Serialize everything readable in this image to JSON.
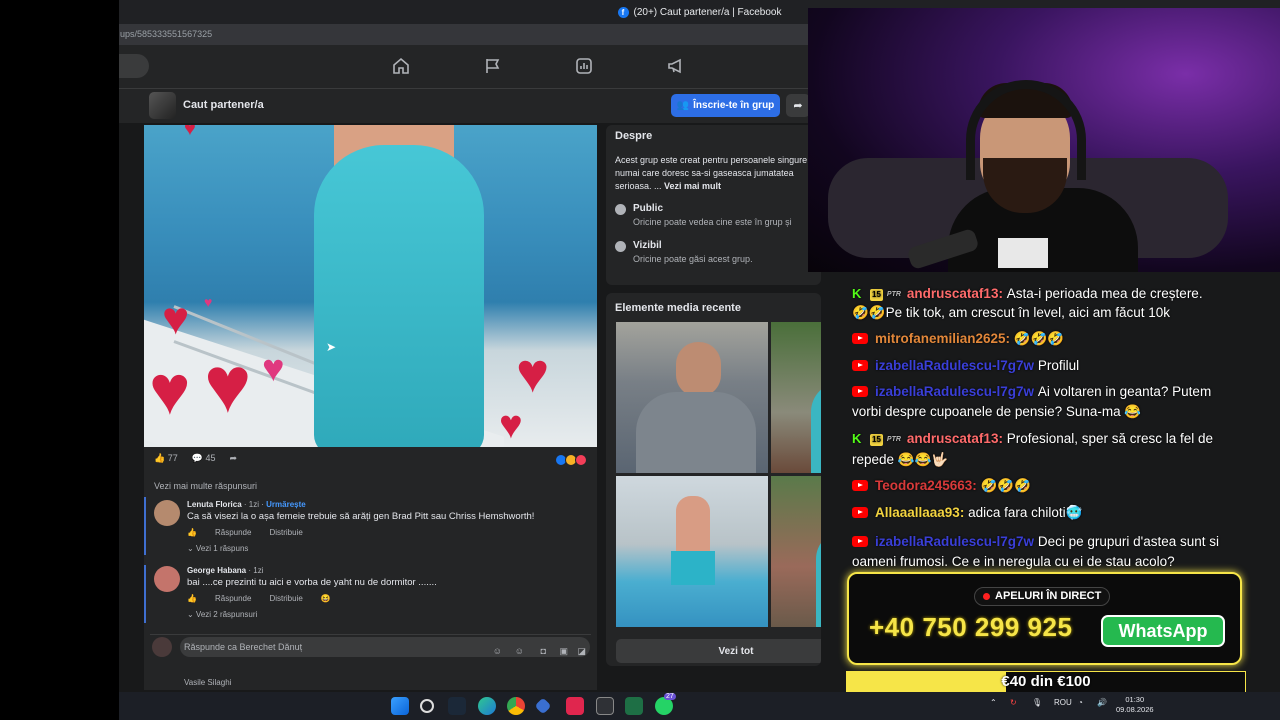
{
  "browser": {
    "title": "(20+) Caut partener/a | Facebook",
    "url_fragment": "ups/585333551567325",
    "favicon": "f"
  },
  "fb_nav": {
    "icons": [
      "home-icon",
      "flag-icon",
      "chart-icon",
      "megaphone-icon"
    ]
  },
  "group": {
    "name": "Caut partener/a",
    "join_label": "Înscrie-te în grup",
    "share_icon": "➦"
  },
  "post": {
    "likes": "77",
    "comments": "45",
    "more_replies": "Vezi mai multe răspunsuri",
    "comments_list": [
      {
        "name": "Lenuta Florica",
        "time": " · 1zi · ",
        "follow": "Urmărește",
        "text": "Ca să visezi la o așa femeie trebuie să arăți gen Brad Pitt sau Chriss Hemshworth!",
        "reply": "Răspunde",
        "share": "Distribuie",
        "replies": "⌄ Vezi 1 răspuns"
      },
      {
        "name": "George Habana",
        "time": " · 1zi",
        "follow": "",
        "text": "bai ....ce prezinti tu aici e vorba de yaht nu de dormitor .......",
        "reply": "Răspunde",
        "share": "Distribuie",
        "replies": "⌄ Vezi 2 răspunsuri"
      }
    ],
    "reply_placeholder": "Răspunde ca Berechet Dănuț",
    "next_commenter": "Vasile Silaghi"
  },
  "about": {
    "title": "Despre",
    "desc": "Acest grup este creat pentru persoanele singure numai care doresc sa-si gaseasca jumatatea serioasa. ... ",
    "see_more": "Vezi mai mult",
    "public_title": "Public",
    "public_sub": "Oricine poate vedea cine este în grup și",
    "visible_title": "Vizibil",
    "visible_sub": "Oricine poate găsi acest grup."
  },
  "media": {
    "title": "Elemente media recente",
    "see_all": "Vezi tot"
  },
  "chat": {
    "messages": [
      {
        "platform": "kick",
        "level": "15",
        "tag": "PTR",
        "user": "andruscataf13:",
        "color": "#ff6b6b",
        "text": "Asta-i perioada mea de creștere."
      },
      {
        "platform": "none",
        "level": "",
        "tag": "",
        "user": "",
        "color": "#ffffff",
        "text": "🤣🤣Pe tik tok, am crescut în level, aici am făcut 10k"
      },
      {
        "platform": "youtube",
        "level": "",
        "tag": "",
        "user": "mitrofanemilian2625:",
        "color": "#e2873a",
        "text": "🤣🤣🤣"
      },
      {
        "platform": "youtube",
        "level": "",
        "tag": "",
        "user": "izabellaRadulescu-l7g7w",
        "color": "#3a3fd8",
        "text": "Profilul"
      },
      {
        "platform": "youtube",
        "level": "",
        "tag": "",
        "user": "izabellaRadulescu-l7g7w",
        "color": "#3a3fd8",
        "text": "Ai voltaren in geanta? Putem vorbi despre cupoanele de pensie? Suna-ma 😂"
      },
      {
        "platform": "kick",
        "level": "15",
        "tag": "PTR",
        "user": "andruscataf13:",
        "color": "#ff6b6b",
        "text": "Profesional, sper să cresc la fel de repede 😂😂🤟🏻"
      },
      {
        "platform": "youtube",
        "level": "",
        "tag": "",
        "user": "Teodora245663:",
        "color": "#d83a3a",
        "text": "🤣🤣🤣"
      },
      {
        "platform": "youtube",
        "level": "",
        "tag": "",
        "user": "Allaaallaaa93:",
        "color": "#f2d340",
        "text": "adica fara chiloti🥶"
      },
      {
        "platform": "youtube",
        "level": "",
        "tag": "",
        "user": "izabellaRadulescu-l7g7w",
        "color": "#3a3fd8",
        "text": "Deci pe grupuri d'astea sunt si oameni frumosi. Ce e in neregula cu ei de stau acolo?"
      }
    ]
  },
  "call": {
    "label": "APELURI ÎN DIRECT",
    "phone": "+40 750 299 925",
    "whatsapp": "WhatsApp",
    "accent": "#f6e548"
  },
  "goal": {
    "text": "€40 din €100",
    "progress": 0.4
  },
  "taskbar": {
    "lang": "ROU",
    "time": "01:30",
    "date": "09.08.2026",
    "badge": "27"
  }
}
